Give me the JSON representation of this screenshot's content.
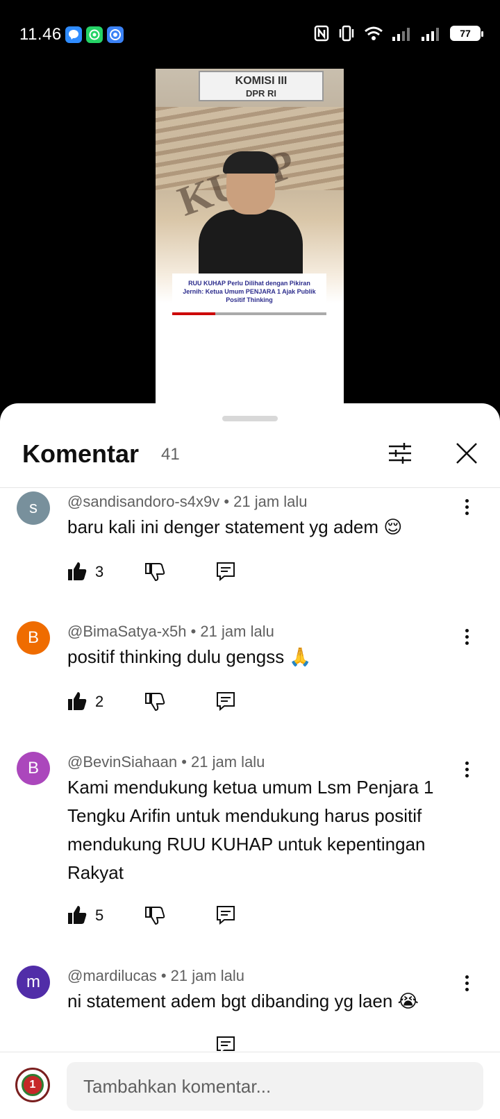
{
  "status": {
    "time": "11.46",
    "battery": "77",
    "app_icons": [
      "messenger-icon",
      "whatsapp-icon",
      "chrome-icon"
    ]
  },
  "video": {
    "sign_line1": "KOMISI III",
    "sign_line2": "DPR RI",
    "stamp": "KUHP",
    "caption": "RUU KUHAP Perlu Dilihat dengan Pikiran Jernih: Ketua Umum PENJARA 1 Ajak Publik Positif Thinking"
  },
  "header": {
    "title": "Komentar",
    "count": "41"
  },
  "comments": [
    {
      "initial": "s",
      "avatar_color": "#78909c",
      "meta": "@sandisandoro-s4x9v • 21 jam lalu",
      "text": "baru kali ini denger statement yg adem 😌",
      "likes": "3"
    },
    {
      "initial": "B",
      "avatar_color": "#ef6c00",
      "meta": "@BimaSatya-x5h • 21 jam lalu",
      "text": "positif thinking dulu gengss 🙏",
      "likes": "2"
    },
    {
      "initial": "B",
      "avatar_color": "#ab47bc",
      "meta": "@BevinSiahaan • 21 jam lalu",
      "text": "Kami mendukung ketua umum Lsm Penjara 1 Tengku Arifin untuk mendukung harus positif mendukung RUU KUHAP untuk kepentingan Rakyat",
      "likes": "5"
    },
    {
      "initial": "m",
      "avatar_color": "#512da8",
      "meta": "@mardilucas • 21 jam lalu",
      "text": "ni statement adem bgt dibanding yg laen 😭",
      "likes": ""
    }
  ],
  "composer": {
    "placeholder": "Tambahkan komentar..."
  }
}
